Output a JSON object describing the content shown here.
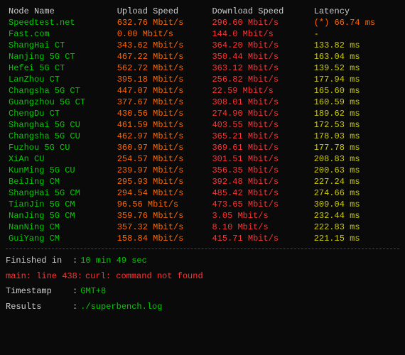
{
  "table": {
    "headers": [
      "Node Name",
      "Upload Speed",
      "Download Speed",
      "Latency"
    ],
    "rows": [
      {
        "node": "Speedtest.net",
        "upload": "632.76 Mbit/s",
        "download": "296.60 Mbit/s",
        "latency": "(*) 66.74 ms",
        "latencySpecial": true
      },
      {
        "node": "Fast.com",
        "upload": "0.00 Mbit/s",
        "download": "144.0 Mbit/s",
        "latency": "-",
        "latencySpecial": false
      },
      {
        "node": "ShangHai  CT",
        "upload": "343.62 Mbit/s",
        "download": "364.20 Mbit/s",
        "latency": "133.82 ms",
        "latencySpecial": false
      },
      {
        "node": "Nanjing 5G  CT",
        "upload": "467.22 Mbit/s",
        "download": "350.44 Mbit/s",
        "latency": "163.04 ms",
        "latencySpecial": false
      },
      {
        "node": "Hefei 5G  CT",
        "upload": "562.72 Mbit/s",
        "download": "363.12 Mbit/s",
        "latency": "139.52 ms",
        "latencySpecial": false
      },
      {
        "node": "LanZhou  CT",
        "upload": "395.18 Mbit/s",
        "download": "256.82 Mbit/s",
        "latency": "177.94 ms",
        "latencySpecial": false
      },
      {
        "node": "Changsha 5G  CT",
        "upload": "447.07 Mbit/s",
        "download": "22.59 Mbit/s",
        "latency": "165.60 ms",
        "latencySpecial": false
      },
      {
        "node": "Guangzhou 5G  CT",
        "upload": "377.67 Mbit/s",
        "download": "308.01 Mbit/s",
        "latency": "160.59 ms",
        "latencySpecial": false
      },
      {
        "node": "ChengDu  CT",
        "upload": "430.56 Mbit/s",
        "download": "274.90 Mbit/s",
        "latency": "189.62 ms",
        "latencySpecial": false
      },
      {
        "node": "Shanghai 5G  CU",
        "upload": "461.59 Mbit/s",
        "download": "403.55 Mbit/s",
        "latency": "172.53 ms",
        "latencySpecial": false
      },
      {
        "node": "Changsha 5G  CU",
        "upload": "462.97 Mbit/s",
        "download": "365.21 Mbit/s",
        "latency": "178.03 ms",
        "latencySpecial": false
      },
      {
        "node": "Fuzhou 5G  CU",
        "upload": "360.97 Mbit/s",
        "download": "369.61 Mbit/s",
        "latency": "177.78 ms",
        "latencySpecial": false
      },
      {
        "node": "XiAn  CU",
        "upload": "254.57 Mbit/s",
        "download": "301.51 Mbit/s",
        "latency": "208.83 ms",
        "latencySpecial": false
      },
      {
        "node": "KunMing 5G  CU",
        "upload": "239.97 Mbit/s",
        "download": "356.35 Mbit/s",
        "latency": "200.63 ms",
        "latencySpecial": false
      },
      {
        "node": "BeiJing  CM",
        "upload": "295.93 Mbit/s",
        "download": "392.48 Mbit/s",
        "latency": "227.24 ms",
        "latencySpecial": false
      },
      {
        "node": "ShangHai 5G  CM",
        "upload": "294.54 Mbit/s",
        "download": "485.42 Mbit/s",
        "latency": "274.66 ms",
        "latencySpecial": false
      },
      {
        "node": "TianJin 5G  CM",
        "upload": "96.56 Mbit/s",
        "download": "473.65 Mbit/s",
        "latency": "309.04 ms",
        "latencySpecial": false
      },
      {
        "node": "NanJing 5G  CM",
        "upload": "359.76 Mbit/s",
        "download": "3.05 Mbit/s",
        "latency": "232.44 ms",
        "latencySpecial": false
      },
      {
        "node": "NanNing  CM",
        "upload": "357.32 Mbit/s",
        "download": "8.10 Mbit/s",
        "latency": "222.83 ms",
        "latencySpecial": false
      },
      {
        "node": "GuiYang  CM",
        "upload": "158.84 Mbit/s",
        "download": "415.71 Mbit/s",
        "latency": "221.15 ms",
        "latencySpecial": false
      }
    ]
  },
  "footer": {
    "finished_label": "Finished in",
    "finished_value": "10 min 49 sec",
    "error_label": "main: line 438:",
    "error_value": "curl: command not found",
    "timestamp_label": "Timestamp",
    "timestamp_value": "GMT+8",
    "results_label": "Results",
    "results_value": "./superbench.log"
  }
}
